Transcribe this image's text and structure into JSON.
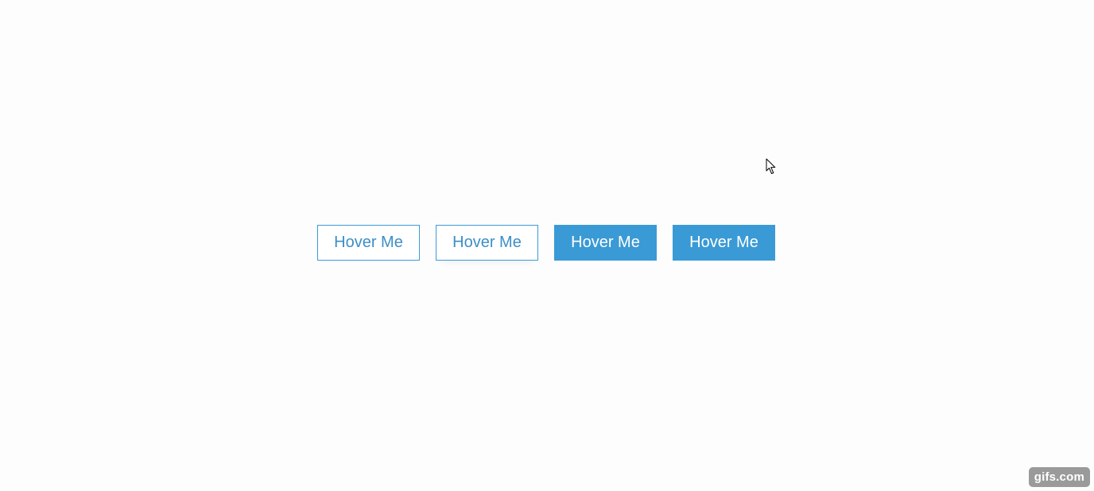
{
  "buttons": [
    {
      "label": "Hover Me",
      "style": "outline"
    },
    {
      "label": "Hover Me",
      "style": "outline"
    },
    {
      "label": "Hover Me",
      "style": "filled"
    },
    {
      "label": "Hover Me",
      "style": "filled"
    }
  ],
  "colors": {
    "accent": "#3a9ad5",
    "outline_text": "#3c8fc6",
    "background": "#fdfdfd"
  },
  "cursor": {
    "icon": "arrow-cursor-icon"
  },
  "watermark": {
    "text": "gifs.com"
  }
}
